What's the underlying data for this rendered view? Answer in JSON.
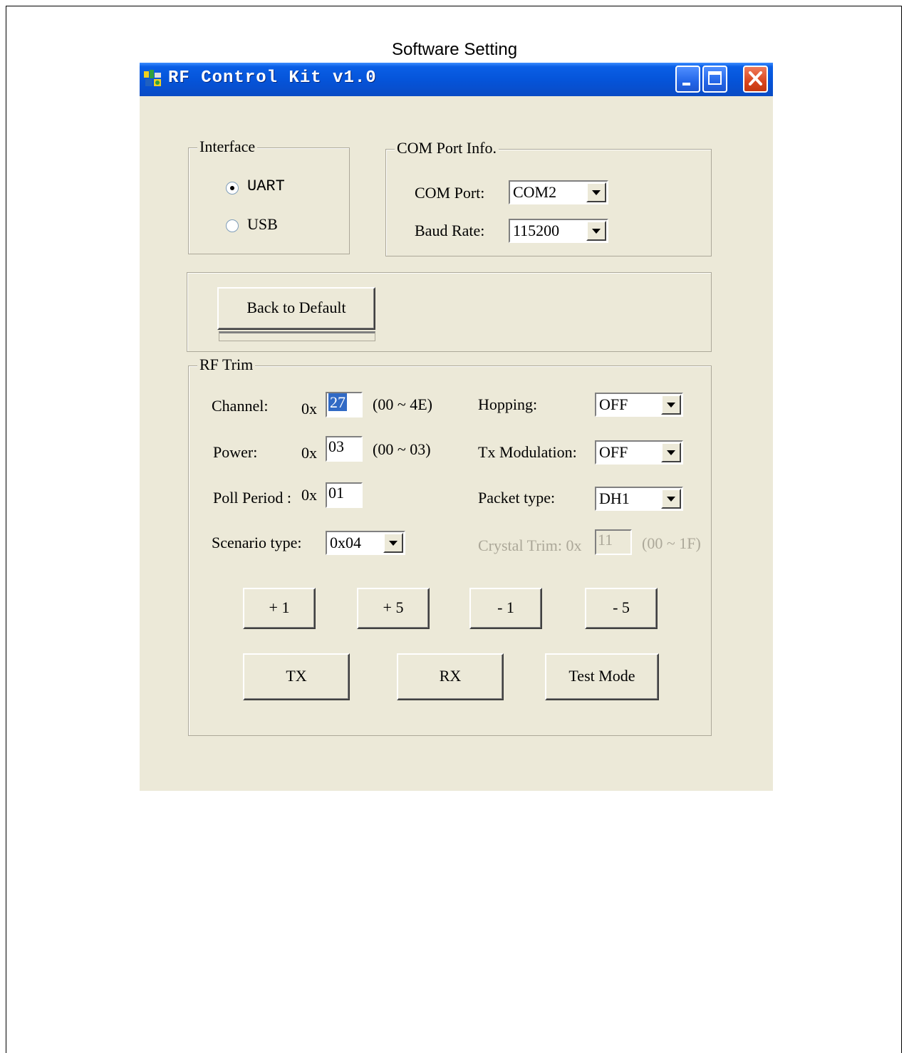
{
  "caption": "Software Setting",
  "window": {
    "title": "RF Control Kit v1.0",
    "icon": "app-icon",
    "controls": [
      "minimize-icon",
      "maximize-icon",
      "close-icon"
    ]
  },
  "interface": {
    "legend": "Interface",
    "options": [
      {
        "label": "UART",
        "selected": true
      },
      {
        "label": "USB",
        "selected": false
      }
    ]
  },
  "com_port_info": {
    "legend": "COM Port Info.",
    "com_port_label": "COM Port:",
    "com_port_value": "COM2",
    "baud_rate_label": "Baud Rate:",
    "baud_rate_value": "115200"
  },
  "default": {
    "button_label": "Back to Default"
  },
  "rf_trim": {
    "legend": "RF Trim",
    "channel_label": "Channel:",
    "hex_prefix": "0x",
    "channel_value": "27",
    "channel_range": "(00 ~ 4E)",
    "power_label": "Power:",
    "power_value": "03",
    "power_range": "(00 ~ 03)",
    "poll_label": "Poll Period :",
    "poll_value": "01",
    "scenario_label": "Scenario type:",
    "scenario_value": "0x04",
    "hopping_label": "Hopping:",
    "hopping_value": "OFF",
    "txmod_label": "Tx Modulation:",
    "txmod_value": "OFF",
    "packet_label": "Packet type:",
    "packet_value": "DH1",
    "crystal_label": "Crystal Trim: 0x",
    "crystal_value": "11",
    "crystal_range": "(00 ~ 1F)",
    "step_buttons": [
      "+ 1",
      "+ 5",
      "- 1",
      "- 5"
    ],
    "action_buttons": [
      "TX",
      "RX",
      "Test Mode"
    ]
  },
  "colors": {
    "dialog_bg": "#ece9d8",
    "titlebar": "#0553d8",
    "close_button": "#d9461e",
    "selection": "#316ac5",
    "disabled_text": "#aca899"
  }
}
